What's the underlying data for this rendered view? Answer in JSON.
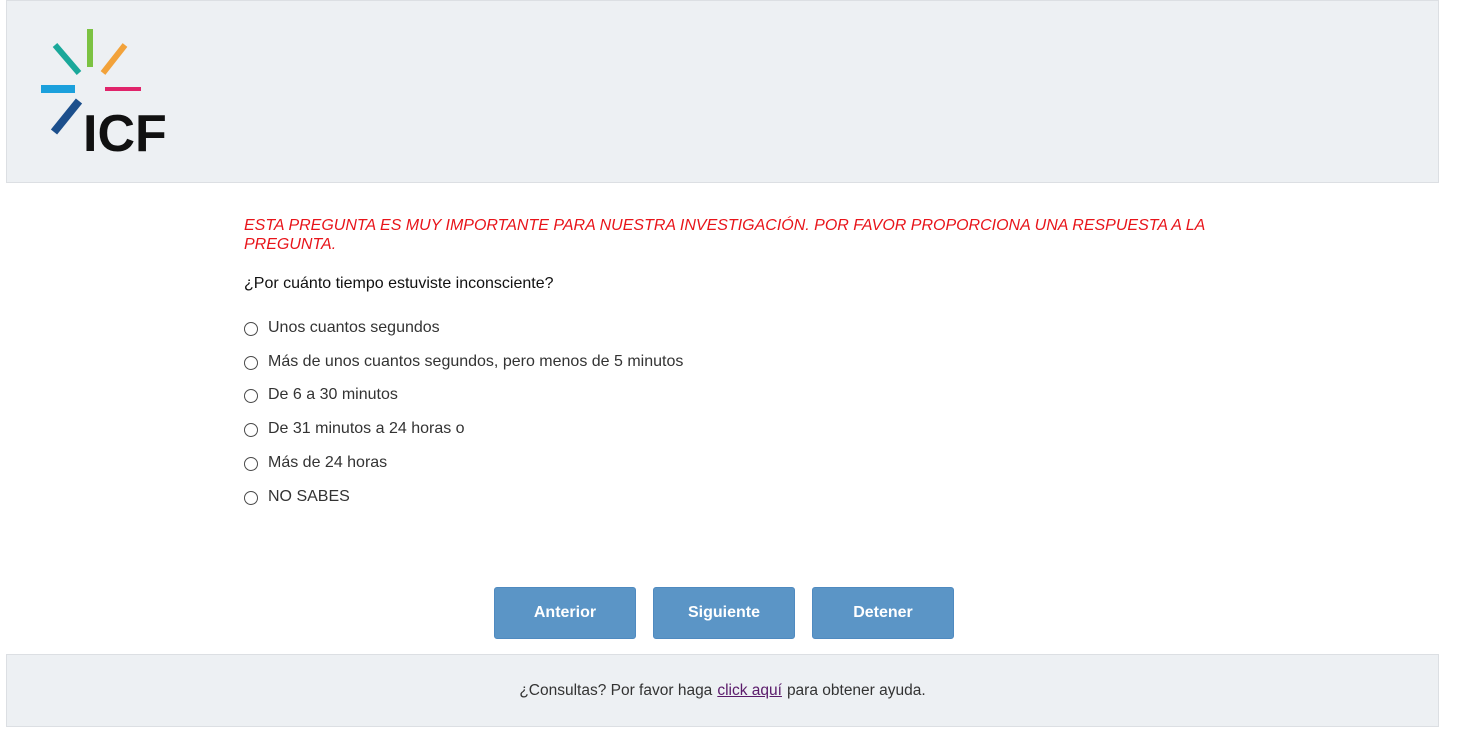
{
  "header": {
    "logo_text": "ICF",
    "colors": {
      "teal": "#1aa89a",
      "green": "#7cc242",
      "orange": "#f2a23a",
      "blue": "#1ba0dc",
      "pink": "#e0246a",
      "navy": "#1c4f8c",
      "text": "#111111"
    }
  },
  "survey": {
    "warning": "ESTA PREGUNTA ES MUY IMPORTANTE PARA NUESTRA INVESTIGACIÓN. POR FAVOR PROPORCIONA UNA RESPUESTA A LA PREGUNTA.",
    "question": "¿Por cuánto tiempo estuviste inconsciente?",
    "options": [
      "Unos cuantos segundos",
      "Más de unos cuantos segundos, pero menos de 5 minutos",
      "De 6 a 30 minutos",
      "De 31 minutos a 24 horas o",
      "Más de 24 horas",
      "NO SABES"
    ],
    "selected_option": null
  },
  "buttons": {
    "previous": "Anterior",
    "next": "Siguiente",
    "stop": "Detener"
  },
  "footer": {
    "text_before": "¿Consultas? Por favor haga",
    "link": "click aquí",
    "text_after": "para obtener ayuda."
  },
  "colors": {
    "warning": "#e8141a",
    "button": "#5b95c6",
    "panel": "#edf0f3",
    "link": "#5a1a6a"
  }
}
